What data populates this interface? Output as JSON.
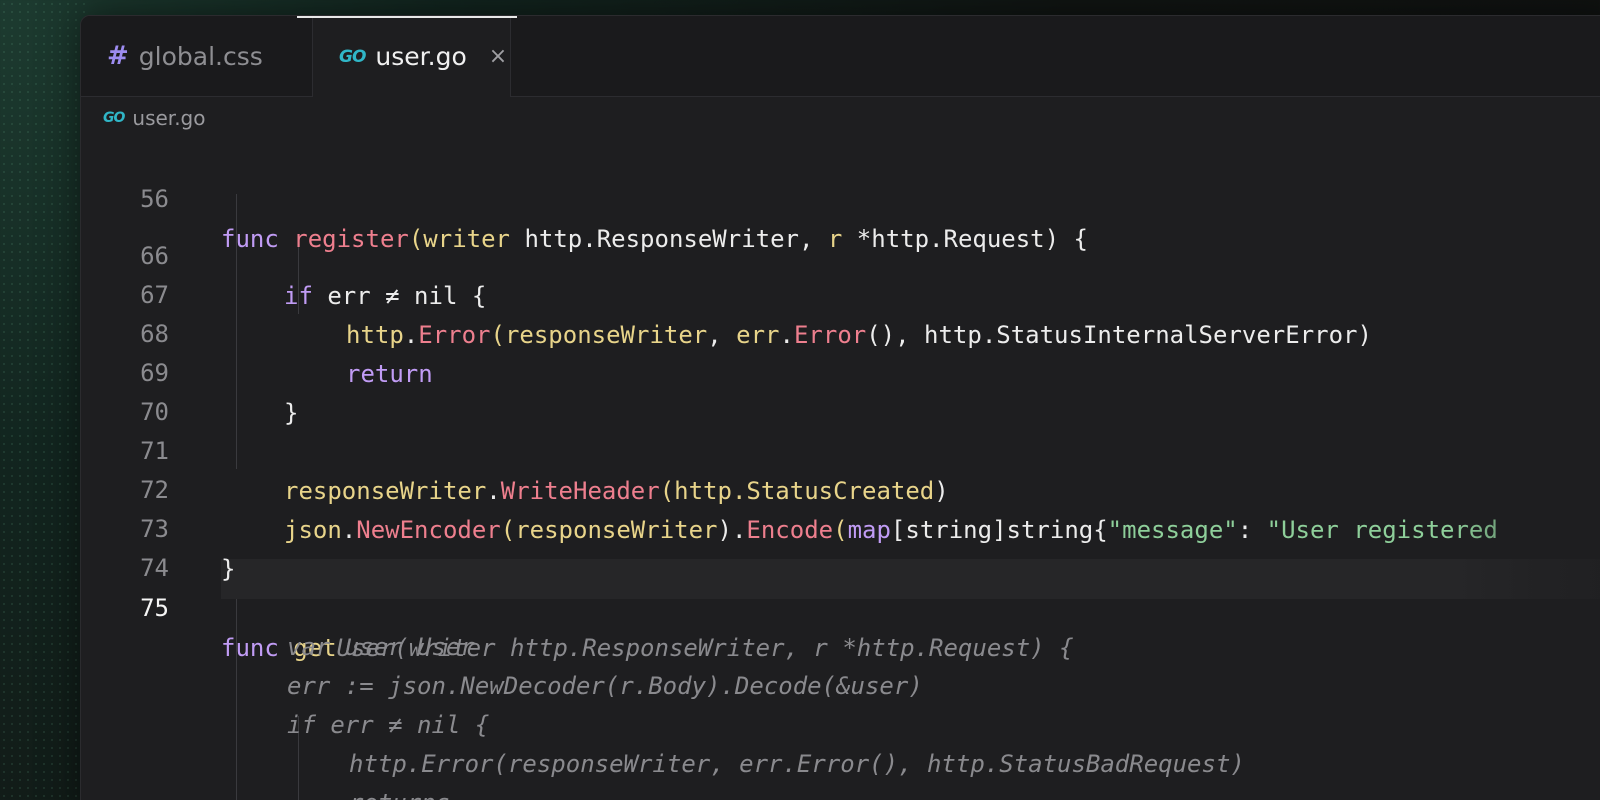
{
  "tabs": [
    {
      "label": "global.css",
      "icon": "hash-icon"
    },
    {
      "label": "user.go",
      "icon": "go-icon",
      "close": "×"
    }
  ],
  "go_icon_text": "GO",
  "hash_icon_text": "#",
  "breadcrumb": {
    "label": "user.go"
  },
  "code": {
    "line56": {
      "num": "56",
      "t1": "func",
      "t2": "register",
      "t3": "(",
      "t4": "writer",
      "t5": " http.ResponseWriter, ",
      "t6": "r",
      "t7": " *http.Request) {"
    },
    "line66": {
      "num": "66",
      "t1": "if",
      "t2": " err ≠ nil {"
    },
    "line67": {
      "num": "67",
      "t1": "http",
      "t2": ".",
      "t3": "Error",
      "t4": "(",
      "t5": "responseWriter",
      "t6": ", ",
      "t7": "err",
      "t8": ".",
      "t9": "Error",
      "t10": "(), http.StatusInternalServerError)"
    },
    "line68": {
      "num": "68",
      "t1": "return"
    },
    "line69": {
      "num": "69",
      "t1": "}"
    },
    "line70": {
      "num": "70"
    },
    "line71": {
      "num": "71",
      "t1": "responseWriter",
      "t2": ".",
      "t3": "WriteHeader",
      "t4": "(",
      "t5": "http.StatusCreated",
      "t6": ")"
    },
    "line72": {
      "num": "72",
      "t1": "json",
      "t2": ".",
      "t3": "NewEncoder",
      "t4": "(",
      "t5": "responseWriter",
      "t6": ").",
      "t7": "Encode",
      "t8": "(",
      "t9": "map",
      "t10": "[string]string{",
      "t11": "\"message\"",
      "t12": ": ",
      "t13": "\"User registered"
    },
    "line73": {
      "num": "73",
      "t1": "}"
    },
    "line74": {
      "num": "74"
    },
    "line75": {
      "num": "75",
      "t1": "func",
      "t2": "get",
      "t3": "User(writer http.ResponseWriter, r *http.Request) {"
    },
    "ghost1": "var user User",
    "ghost2": "err := json.NewDecoder(r.Body).Decode(&user)",
    "ghost3": "if err ≠ nil {",
    "ghost4": "http.Error(responseWriter, err.Error(), http.StatusBadRequest)",
    "ghost5": "returns"
  },
  "colors": {
    "keyword": "#c19cf5",
    "function": "#ee7f8e",
    "variable": "#e8d48a",
    "string": "#8ecf9a",
    "ghost_text": "#8a8a8e"
  }
}
